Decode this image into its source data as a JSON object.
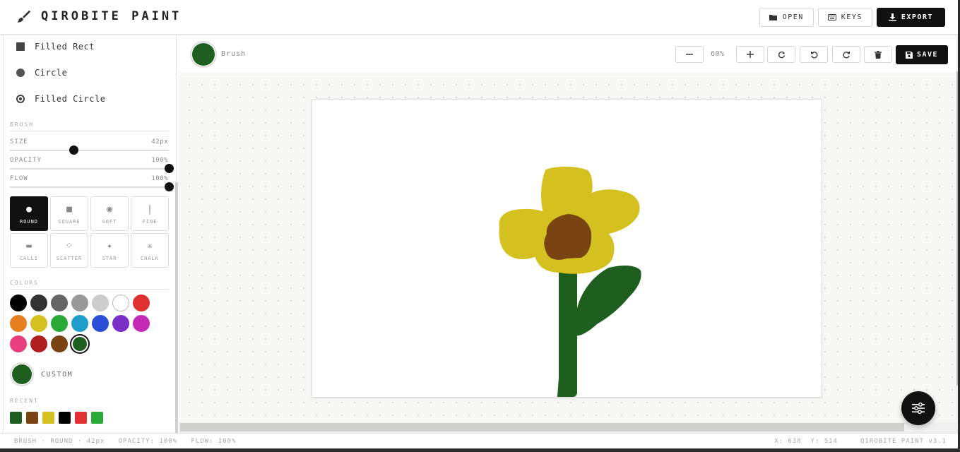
{
  "app": {
    "title": "QIROBITE PAINT"
  },
  "header": {
    "open_label": "OPEN",
    "keys_label": "KEYS",
    "export_label": "EXPORT"
  },
  "shapes": [
    {
      "label": "Filled Rect",
      "icon": "filled-square-icon"
    },
    {
      "label": "Circle",
      "icon": "circle-icon"
    },
    {
      "label": "Filled Circle",
      "icon": "filled-circle-icon"
    }
  ],
  "brush": {
    "section_label": "BRUSH",
    "size_label": "SIZE",
    "size_value": "42px",
    "size_fraction": 0.4,
    "opacity_label": "OPACITY",
    "opacity_value": "100%",
    "opacity_fraction": 1.0,
    "flow_label": "FLOW",
    "flow_value": "100%",
    "flow_fraction": 1.0,
    "types": [
      {
        "label": "ROUND",
        "glyph": "●",
        "active": true
      },
      {
        "label": "SQUARE",
        "glyph": "■",
        "active": false
      },
      {
        "label": "SOFT",
        "glyph": "◉",
        "active": false
      },
      {
        "label": "FINE",
        "glyph": "|",
        "active": false
      },
      {
        "label": "CALLI",
        "glyph": "▬",
        "active": false
      },
      {
        "label": "SCATTER",
        "glyph": "⁘",
        "active": false
      },
      {
        "label": "STAR",
        "glyph": "✦",
        "active": false
      },
      {
        "label": "CHALK",
        "glyph": "✳",
        "active": false
      }
    ]
  },
  "colors": {
    "section_label": "COLORS",
    "palette": [
      "#000000",
      "#333333",
      "#666666",
      "#999999",
      "#cccccc",
      "#ffffff",
      "#e03030",
      "#e67e22",
      "#d4c11f",
      "#2aa838",
      "#1f9ecc",
      "#2a4fd6",
      "#7a2fc9",
      "#c42ab4",
      "#e83e7d",
      "#b01f1f",
      "#7a4412",
      "#1e5e1e"
    ],
    "selected": "#1e5e1e",
    "custom_label": "CUSTOM",
    "custom_color": "#1e5e1e",
    "recent_label": "RECENT",
    "recent": [
      "#1e5e1e",
      "#7a4412",
      "#d4c11f",
      "#000000",
      "#e03030",
      "#2aa838"
    ]
  },
  "toolbar": {
    "current_tool": "Brush",
    "current_color": "#1e5e1e",
    "zoom": "60%",
    "save_label": "SAVE"
  },
  "status": {
    "left": "BRUSH · ROUND · 42px   OPACITY: 100%   FLOW: 100%",
    "coords": "X: 638  Y: 514",
    "version": "QIROBITE PAINT v3.1"
  },
  "artwork": {
    "petal_color": "#d4c11f",
    "center_color": "#7a4412",
    "stem_color": "#1e5e1e"
  }
}
